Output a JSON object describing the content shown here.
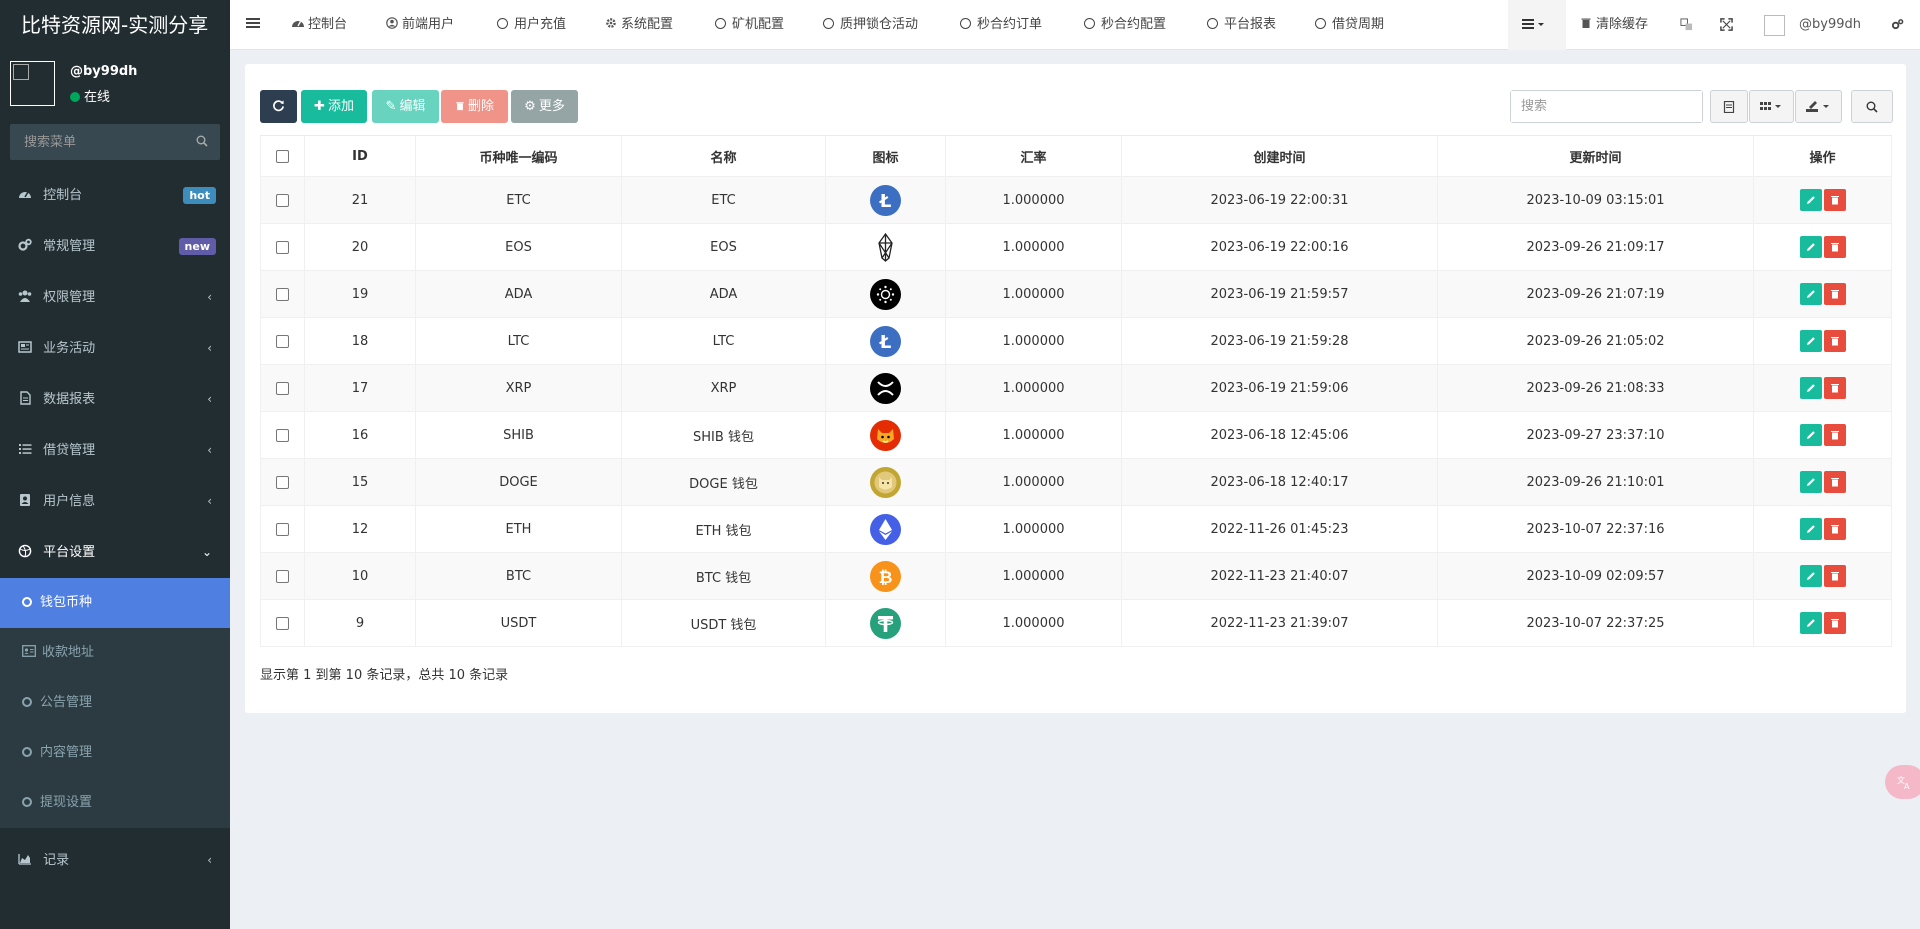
{
  "brand": {
    "title": "比特资源网-实测分享"
  },
  "user": {
    "name": "@by99dh",
    "status": "在线"
  },
  "sidebar_search": {
    "placeholder": "搜索菜单"
  },
  "sidebar": {
    "items": [
      {
        "label": "控制台",
        "badge": "hot",
        "icon": "dashboard-icon"
      },
      {
        "label": "常规管理",
        "badge": "new",
        "icon": "cogs-icon"
      },
      {
        "label": "权限管理",
        "icon": "group-icon"
      },
      {
        "label": "业务活动",
        "icon": "newspaper-icon"
      },
      {
        "label": "数据报表",
        "icon": "file-text-icon"
      },
      {
        "label": "借贷管理",
        "icon": "list-icon"
      },
      {
        "label": "用户信息",
        "icon": "id-card-icon"
      },
      {
        "label": "平台设置",
        "icon": "dribbble-icon"
      }
    ],
    "subitems": [
      {
        "label": "钱包币种",
        "active": true
      },
      {
        "label": "收款地址"
      },
      {
        "label": "公告管理"
      },
      {
        "label": "内容管理"
      },
      {
        "label": "提现设置"
      }
    ],
    "last": {
      "label": "记录",
      "icon": "area-chart-icon"
    }
  },
  "header": {
    "tabs": [
      "控制台",
      "前端用户",
      "用户充值",
      "系统配置",
      "矿机配置",
      "质押锁仓活动",
      "秒合约订单",
      "秒合约配置",
      "平台报表",
      "借贷周期"
    ],
    "clear_cache": "清除缓存",
    "username": "@by99dh"
  },
  "toolbar": {
    "add": "添加",
    "edit": "编辑",
    "delete": "删除",
    "more": "更多",
    "search_placeholder": "搜索"
  },
  "table": {
    "columns": [
      "ID",
      "币种唯一编码",
      "名称",
      "图标",
      "汇率",
      "创建时间",
      "更新时间",
      "操作"
    ],
    "rows": [
      {
        "id": "21",
        "code": "ETC",
        "name": "ETC",
        "icon": "ltc-icon",
        "rate": "1.000000",
        "created": "2023-06-19 22:00:31",
        "updated": "2023-10-09 03:15:01"
      },
      {
        "id": "20",
        "code": "EOS",
        "name": "EOS",
        "icon": "eos-icon",
        "rate": "1.000000",
        "created": "2023-06-19 22:00:16",
        "updated": "2023-09-26 21:09:17"
      },
      {
        "id": "19",
        "code": "ADA",
        "name": "ADA",
        "icon": "ada-icon",
        "rate": "1.000000",
        "created": "2023-06-19 21:59:57",
        "updated": "2023-09-26 21:07:19"
      },
      {
        "id": "18",
        "code": "LTC",
        "name": "LTC",
        "icon": "ltc-icon",
        "rate": "1.000000",
        "created": "2023-06-19 21:59:28",
        "updated": "2023-09-26 21:05:02"
      },
      {
        "id": "17",
        "code": "XRP",
        "name": "XRP",
        "icon": "xrp-icon",
        "rate": "1.000000",
        "created": "2023-06-19 21:59:06",
        "updated": "2023-09-26 21:08:33"
      },
      {
        "id": "16",
        "code": "SHIB",
        "name": "SHIB 钱包",
        "icon": "shib-icon",
        "rate": "1.000000",
        "created": "2023-06-18 12:45:06",
        "updated": "2023-09-27 23:37:10"
      },
      {
        "id": "15",
        "code": "DOGE",
        "name": "DOGE 钱包",
        "icon": "doge-icon",
        "rate": "1.000000",
        "created": "2023-06-18 12:40:17",
        "updated": "2023-09-26 21:10:01"
      },
      {
        "id": "12",
        "code": "ETH",
        "name": "ETH 钱包",
        "icon": "eth-icon",
        "rate": "1.000000",
        "created": "2022-11-26 01:45:23",
        "updated": "2023-10-07 22:37:16"
      },
      {
        "id": "10",
        "code": "BTC",
        "name": "BTC 钱包",
        "icon": "btc-icon",
        "rate": "1.000000",
        "created": "2022-11-23 21:40:07",
        "updated": "2023-10-09 02:09:57"
      },
      {
        "id": "9",
        "code": "USDT",
        "name": "USDT 钱包",
        "icon": "usdt-icon",
        "rate": "1.000000",
        "created": "2022-11-23 21:39:07",
        "updated": "2023-10-07 22:37:25"
      }
    ]
  },
  "pager": {
    "summary": "显示第 1 到第 10 条记录，总共 10 条记录"
  },
  "colors": {
    "sidebar_bg": "#222d32",
    "active": "#4f7fe0",
    "success": "#18bc9c",
    "danger": "#e74c3c"
  }
}
